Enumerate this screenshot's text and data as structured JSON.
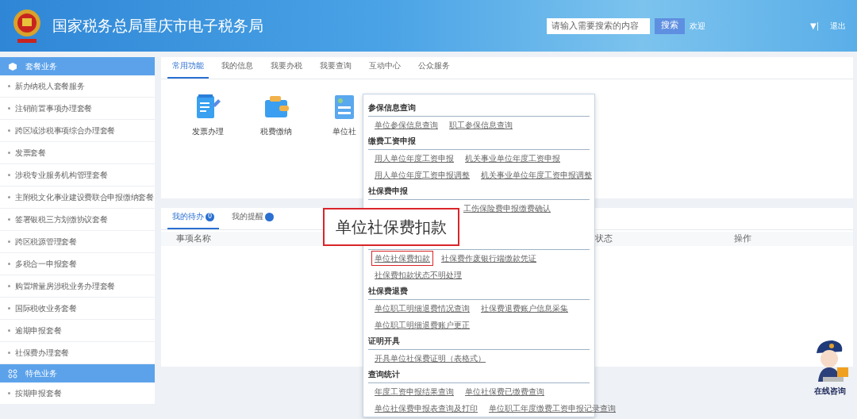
{
  "header": {
    "title": "国家税务总局重庆市电子税务局",
    "search": {
      "placeholder": "请输入需要搜索的内容",
      "button": "搜索"
    },
    "welcome": "欢迎",
    "menu_toggle": "▼|",
    "logout": "退出"
  },
  "sidebar": {
    "sections": [
      {
        "title": "套餐业务",
        "items": [
          "新办纳税人套餐服务",
          "注销前置事项办理套餐",
          "跨区域涉税事项综合办理套餐",
          "发票套餐",
          "涉税专业服务机构管理套餐",
          "主附税文化事业建设费联合申报缴纳套餐",
          "签署银税三方划缴协议套餐",
          "跨区税源管理套餐",
          "多税合一申报套餐",
          "购置增量房涉税业务办理套餐",
          "国际税收业务套餐",
          "逾期申报套餐",
          "社保费办理套餐"
        ]
      },
      {
        "title": "特色业务",
        "items": [
          "按期申报套餐"
        ]
      }
    ]
  },
  "top_tabs": [
    {
      "label": "常用功能",
      "selected": true
    },
    {
      "label": "我的信息",
      "selected": false
    },
    {
      "label": "我要办税",
      "selected": false
    },
    {
      "label": "我要查询",
      "selected": false
    },
    {
      "label": "互动中心",
      "selected": false
    },
    {
      "label": "公众服务",
      "selected": false
    }
  ],
  "shortcuts": [
    {
      "label": "发票办理"
    },
    {
      "label": "税费缴纳"
    },
    {
      "label": "单位社"
    }
  ],
  "todo_tabs": [
    {
      "label": "我的待办",
      "count": "0",
      "selected": true
    },
    {
      "label": "我的提醒",
      "selected": false
    }
  ],
  "table": {
    "columns": [
      "事项名称",
      "状态",
      "操作"
    ]
  },
  "dropdown": {
    "sections": [
      {
        "title": "参保信息查询",
        "rows": [
          [
            {
              "label": "单位参保信息查询",
              "highlighted": false
            },
            {
              "label": "职工参保信息查询",
              "highlighted": false
            }
          ]
        ]
      },
      {
        "title": "缴费工资申报",
        "rows": [
          [
            {
              "label": "用人单位年度工资申报",
              "highlighted": false
            },
            {
              "label": "机关事业单位年度工资申报",
              "highlighted": false
            }
          ],
          [
            {
              "label": "用人单位年度工资申报调整",
              "highlighted": false
            },
            {
              "label": "机关事业单位年度工资申报调整",
              "highlighted": false
            }
          ]
        ]
      },
      {
        "title": "社保费申报",
        "rows": [
          [
            {
              "label": "工伤保险费申报缴费确认",
              "highlighted": false,
              "covered": true
            }
          ]
        ]
      },
      {
        "rows": [
          [
            {
              "label": "单位社保费扣款",
              "highlighted": true
            },
            {
              "label": "社保费作废银行端缴款凭证",
              "highlighted": false
            }
          ],
          [
            {
              "label": "社保费扣款状态不明处理",
              "highlighted": false
            }
          ]
        ]
      },
      {
        "title": "社保费退费",
        "rows": [
          [
            {
              "label": "单位职工明细退费情况查询",
              "highlighted": false
            },
            {
              "label": "社保费退费账户信息采集",
              "highlighted": false
            }
          ],
          [
            {
              "label": "单位职工明细退费账户更正",
              "highlighted": false
            }
          ]
        ]
      },
      {
        "title": "证明开具",
        "rows": [
          [
            {
              "label": "开具单位社保费证明（表格式）",
              "highlighted": false
            }
          ]
        ]
      },
      {
        "title": "查询统计",
        "rows": [
          [
            {
              "label": "年度工资申报结果查询",
              "highlighted": false
            },
            {
              "label": "单位社保费已缴费查询",
              "highlighted": false
            }
          ],
          [
            {
              "label": "单位社保费申报表查询及打印",
              "highlighted": false
            },
            {
              "label": "单位职工年度缴费工资申报记录查询",
              "highlighted": false
            }
          ]
        ]
      }
    ]
  },
  "callout": "单位社保费扣款",
  "assistant": {
    "label": "在线咨询"
  }
}
